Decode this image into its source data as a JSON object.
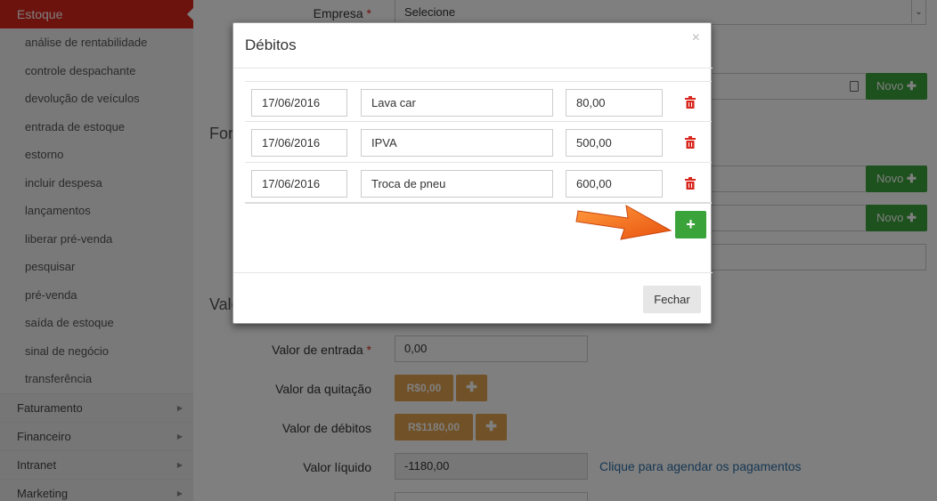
{
  "sidebar": {
    "active": "Estoque",
    "sub_items": [
      "análise de rentabilidade",
      "controle despachante",
      "devolução de veículos",
      "entrada de estoque",
      "estorno",
      "incluir despesa",
      "lançamentos",
      "liberar pré-venda",
      "pesquisar",
      "pré-venda",
      "saída de estoque",
      "sinal de negócio",
      "transferência"
    ],
    "main_items": [
      "Faturamento",
      "Financeiro",
      "Intranet",
      "Marketing"
    ]
  },
  "form": {
    "empresa_label": "Empresa",
    "empresa_value": "Selecione",
    "section_for": "For",
    "section_val": "Valo",
    "novo_label": "Novo",
    "valor_entrada_label": "Valor de entrada",
    "valor_entrada_value": "0,00",
    "valor_quitacao_label": "Valor da quitação",
    "valor_quitacao_value": "R$0,00",
    "valor_debitos_label": "Valor de débitos",
    "valor_debitos_value": "R$1180,00",
    "valor_liquido_label": "Valor líquido",
    "valor_liquido_value": "-1180,00",
    "agendar_link": "Clique para agendar os pagamentos"
  },
  "modal": {
    "title": "Débitos",
    "close": "×",
    "rows": [
      {
        "date": "17/06/2016",
        "desc": "Lava car",
        "value": "80,00"
      },
      {
        "date": "17/06/2016",
        "desc": "IPVA",
        "value": "500,00"
      },
      {
        "date": "17/06/2016",
        "desc": "Troca de pneu",
        "value": "600,00"
      }
    ],
    "add_label": "+",
    "fechar_label": "Fechar"
  },
  "colors": {
    "accent_red": "#d9261c",
    "green": "#3aa33a",
    "orange_btn": "#e3a24f",
    "arrow": "#f26a1b"
  }
}
